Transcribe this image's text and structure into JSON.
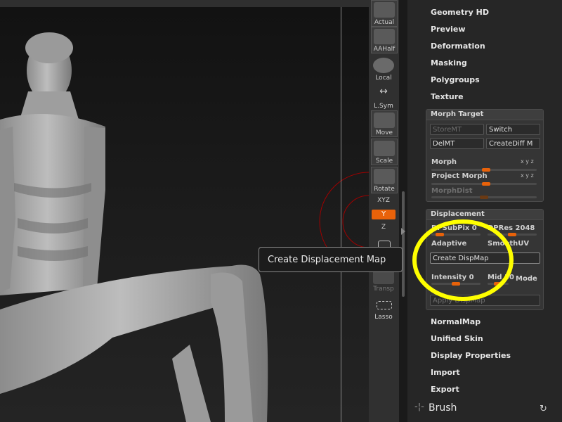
{
  "toolbar": {
    "tools": [
      {
        "label": "Actual",
        "icon": "zoom-actual-icon"
      },
      {
        "label": "AAHalf",
        "icon": "zoom-aahalf-icon"
      },
      {
        "label": "Local",
        "icon": "local-icon"
      },
      {
        "label": "L.Sym",
        "icon": "symmetry-icon"
      },
      {
        "label": "Move",
        "icon": "move-hand-icon"
      },
      {
        "label": "Scale",
        "icon": "scale-icon"
      },
      {
        "label": "Rotate",
        "icon": "rotate-icon"
      },
      {
        "label": "XYZ",
        "icon": "xyz-axis-icon"
      },
      {
        "label": "Transp",
        "icon": "transparency-icon"
      },
      {
        "label": "Lasso",
        "icon": "lasso-icon"
      }
    ],
    "y_label": "Y",
    "z_label": "Z",
    "active_color": "#e8620a"
  },
  "menu": {
    "top_items": [
      "Geometry HD",
      "Preview",
      "Deformation",
      "Masking",
      "Polygroups",
      "Texture"
    ],
    "bottom_items": [
      "NormalMap",
      "Unified Skin",
      "Display Properties",
      "Import",
      "Export"
    ]
  },
  "morph_target": {
    "title": "Morph Target",
    "store_label": "StoreMT",
    "switch_label": "Switch",
    "del_label": "DelMT",
    "creatediff_label": "CreateDiff M",
    "morph_label": "Morph",
    "project_label": "Project Morph",
    "morphdist_label": "MorphDist",
    "xyz_label": "x y z",
    "morph_value": 0.52,
    "project_value": 0.52,
    "morphdist_value": 0.5
  },
  "displacement": {
    "title": "Displacement",
    "dpsubpix_label": "DPSubPix 0",
    "dpres_label": "DPRes 2048",
    "adaptive_label": "Adaptive",
    "smoothuv_label": "SmoothUV",
    "create_label": "Create DispMap",
    "intensity_label": "Intensity 0",
    "mid_label": "Mid 50",
    "mode_label": "Mode",
    "apply_label": "Apply DispMap",
    "dpsubpix_value": 0.1,
    "dpres_value": 0.5,
    "intensity_value": 0.5,
    "mid_value": 0.5
  },
  "tooltip": {
    "text": "Create Displacement Map"
  },
  "brush": {
    "label": "Brush"
  },
  "colors": {
    "highlight": "#ffff00",
    "slider": "#e8620a",
    "guide_circle": "#a00000"
  }
}
